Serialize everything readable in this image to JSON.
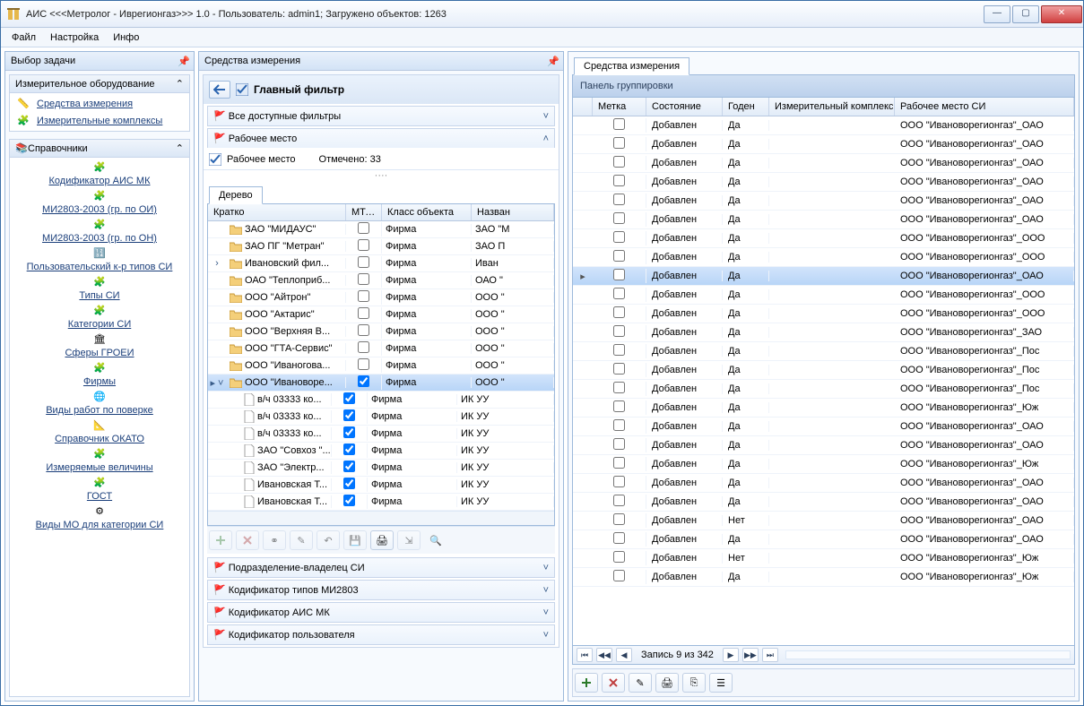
{
  "window": {
    "title": "АИС <<<Метролог - Иврегионгаз>>> 1.0 -  Пользователь: admin1; Загружено объектов: 1263"
  },
  "menu": {
    "file": "Файл",
    "settings": "Настройка",
    "info": "Инфо"
  },
  "sidebar": {
    "title": "Выбор задачи",
    "section1": {
      "title": "Измерительное оборудование",
      "links": [
        "Средства измерения",
        "Измерительные комплексы"
      ]
    },
    "section2": {
      "title": "Справочники",
      "items": [
        "Кодификатор АИС МК",
        "МИ2803-2003 (гр. по ОИ)",
        "МИ2803-2003 (гр. по ОН)",
        "Пользовательский к-р типов СИ",
        "Типы СИ",
        "Категории СИ",
        "Сферы ГРОЕИ",
        "Фирмы",
        "Виды работ по поверке",
        "Справочник ОКАТО",
        "Измеряемые величины",
        "ГОСТ",
        "Виды МО для категории СИ"
      ]
    }
  },
  "mid": {
    "title": "Средства измерения",
    "main_filter": "Главный фильтр",
    "f_all": "Все доступные фильтры",
    "f_place": "Рабочее место",
    "f_place_sub": "Рабочее место",
    "marked": "Отмечено:  33",
    "tree_tab": "Дерево",
    "cols": {
      "c1": "Кратко",
      "c2": "МТерр",
      "c3": "Класс объекта",
      "c4": "Назван"
    },
    "rows": [
      {
        "exp": "",
        "ic": "fo",
        "n": "ЗАО \"МИДАУС\"",
        "m": false,
        "k": "Фирма",
        "nm": "ЗАО \"М"
      },
      {
        "exp": "",
        "ic": "fo",
        "n": "ЗАО ПГ \"Метран\"",
        "m": false,
        "k": "Фирма",
        "nm": "ЗАО П"
      },
      {
        "exp": "›",
        "ic": "fo",
        "n": "Ивановский фил...",
        "m": false,
        "k": "Фирма",
        "nm": "Иван"
      },
      {
        "exp": "",
        "ic": "fo",
        "n": "ОАО \"Теплоприб...",
        "m": false,
        "k": "Фирма",
        "nm": "ОАО \""
      },
      {
        "exp": "",
        "ic": "fo",
        "n": "ООО \"Айтрон\"",
        "m": false,
        "k": "Фирма",
        "nm": "ООО \""
      },
      {
        "exp": "",
        "ic": "fo",
        "n": "ООО \"Актарис\"",
        "m": false,
        "k": "Фирма",
        "nm": "ООО \""
      },
      {
        "exp": "",
        "ic": "fo",
        "n": "ООО \"Верхняя В...",
        "m": false,
        "k": "Фирма",
        "nm": "ООО \""
      },
      {
        "exp": "",
        "ic": "fo",
        "n": "ООО \"ГТА-Сервис\"",
        "m": false,
        "k": "Фирма",
        "nm": "ООО \""
      },
      {
        "exp": "",
        "ic": "fo",
        "n": "ООО \"Иваногова...",
        "m": false,
        "k": "Фирма",
        "nm": "ООО \""
      },
      {
        "exp": "▸ ˅",
        "ic": "fo",
        "n": "ООО \"Ивановоре...",
        "m": true,
        "k": "Фирма",
        "nm": "ООО \"",
        "sel": true
      },
      {
        "exp": "",
        "ic": "fi",
        "n": "в/ч 03333 ко...",
        "m": true,
        "k": "Фирма",
        "nm": "ИК УУ",
        "ind": 1
      },
      {
        "exp": "",
        "ic": "fi",
        "n": "в/ч 03333 ко...",
        "m": true,
        "k": "Фирма",
        "nm": "ИК УУ",
        "ind": 1
      },
      {
        "exp": "",
        "ic": "fi",
        "n": "в/ч 03333 ко...",
        "m": true,
        "k": "Фирма",
        "nm": "ИК УУ",
        "ind": 1
      },
      {
        "exp": "",
        "ic": "fi",
        "n": "ЗАО \"Совхоз \"...",
        "m": true,
        "k": "Фирма",
        "nm": "ИК УУ",
        "ind": 1
      },
      {
        "exp": "",
        "ic": "fi",
        "n": "ЗАО \"Электр...",
        "m": true,
        "k": "Фирма",
        "nm": "ИК УУ",
        "ind": 1
      },
      {
        "exp": "",
        "ic": "fi",
        "n": "Ивановская Т...",
        "m": true,
        "k": "Фирма",
        "nm": "ИК УУ",
        "ind": 1
      },
      {
        "exp": "",
        "ic": "fi",
        "n": "Ивановская Т...",
        "m": true,
        "k": "Фирма",
        "nm": "ИК УУ",
        "ind": 1
      }
    ],
    "filters_below": [
      "Подразделение-владелец СИ",
      "Кодификатор типов МИ2803",
      "Кодификатор АИС МК",
      "Кодификатор пользователя"
    ]
  },
  "right": {
    "tab": "Средства измерения",
    "group": "Панель группировки",
    "cols": {
      "c0": "",
      "c1": "Метка",
      "c2": "Состояние",
      "c3": "Годен",
      "c4": "Измерительный комплекс",
      "c5": "Рабочее место СИ"
    },
    "rows": [
      {
        "s": "Добавлен",
        "g": "Да",
        "m": "<null>",
        "r": "ООО \"Ивановорегионгаз\"_ОАО"
      },
      {
        "s": "Добавлен",
        "g": "Да",
        "m": "<null>",
        "r": "ООО \"Ивановорегионгаз\"_ОАО"
      },
      {
        "s": "Добавлен",
        "g": "Да",
        "m": "<null>",
        "r": "ООО \"Ивановорегионгаз\"_ОАО"
      },
      {
        "s": "Добавлен",
        "g": "Да",
        "m": "<null>",
        "r": "ООО \"Ивановорегионгаз\"_ОАО"
      },
      {
        "s": "Добавлен",
        "g": "Да",
        "m": "<null>",
        "r": "ООО \"Ивановорегионгаз\"_ОАО"
      },
      {
        "s": "Добавлен",
        "g": "Да",
        "m": "<null>",
        "r": "ООО \"Ивановорегионгаз\"_ОАО"
      },
      {
        "s": "Добавлен",
        "g": "Да",
        "m": "<null>",
        "r": "ООО \"Ивановорегионгаз\"_ООО"
      },
      {
        "s": "Добавлен",
        "g": "Да",
        "m": "<null>",
        "r": "ООО \"Ивановорегионгаз\"_ООО"
      },
      {
        "s": "Добавлен",
        "g": "Да",
        "m": "<null>",
        "r": "ООО \"Ивановорегионгаз\"_ОАО",
        "sel": true,
        "mark": "▸"
      },
      {
        "s": "Добавлен",
        "g": "Да",
        "m": "<null>",
        "r": "ООО \"Ивановорегионгаз\"_ООО"
      },
      {
        "s": "Добавлен",
        "g": "Да",
        "m": "<null>",
        "r": "ООО \"Ивановорегионгаз\"_ООО"
      },
      {
        "s": "Добавлен",
        "g": "Да",
        "m": "<null>",
        "r": "ООО \"Ивановорегионгаз\"_ЗАО"
      },
      {
        "s": "Добавлен",
        "g": "Да",
        "m": "<null>",
        "r": "ООО \"Ивановорегионгаз\"_Пос"
      },
      {
        "s": "Добавлен",
        "g": "Да",
        "m": "<null>",
        "r": "ООО \"Ивановорегионгаз\"_Пос"
      },
      {
        "s": "Добавлен",
        "g": "Да",
        "m": "<null>",
        "r": "ООО \"Ивановорегионгаз\"_Пос"
      },
      {
        "s": "Добавлен",
        "g": "Да",
        "m": "<null>",
        "r": "ООО \"Ивановорегионгаз\"_Юж"
      },
      {
        "s": "Добавлен",
        "g": "Да",
        "m": "<null>",
        "r": "ООО \"Ивановорегионгаз\"_ОАО"
      },
      {
        "s": "Добавлен",
        "g": "Да",
        "m": "<null>",
        "r": "ООО \"Ивановорегионгаз\"_ОАО"
      },
      {
        "s": "Добавлен",
        "g": "Да",
        "m": "<null>",
        "r": "ООО \"Ивановорегионгаз\"_Юж"
      },
      {
        "s": "Добавлен",
        "g": "Да",
        "m": "<null>",
        "r": "ООО \"Ивановорегионгаз\"_ОАО"
      },
      {
        "s": "Добавлен",
        "g": "Да",
        "m": "<null>",
        "r": "ООО \"Ивановорегионгаз\"_ОАО"
      },
      {
        "s": "Добавлен",
        "g": "Нет",
        "m": "<null>",
        "r": "ООО \"Ивановорегионгаз\"_ОАО"
      },
      {
        "s": "Добавлен",
        "g": "Да",
        "m": "<null>",
        "r": "ООО \"Ивановорегионгаз\"_ОАО"
      },
      {
        "s": "Добавлен",
        "g": "Нет",
        "m": "<null>",
        "r": "ООО \"Ивановорегионгаз\"_Юж"
      },
      {
        "s": "Добавлен",
        "g": "Да",
        "m": "<null>",
        "r": "ООО \"Ивановорегионгаз\"_Юж"
      }
    ],
    "record": "Запись 9 из 342"
  }
}
